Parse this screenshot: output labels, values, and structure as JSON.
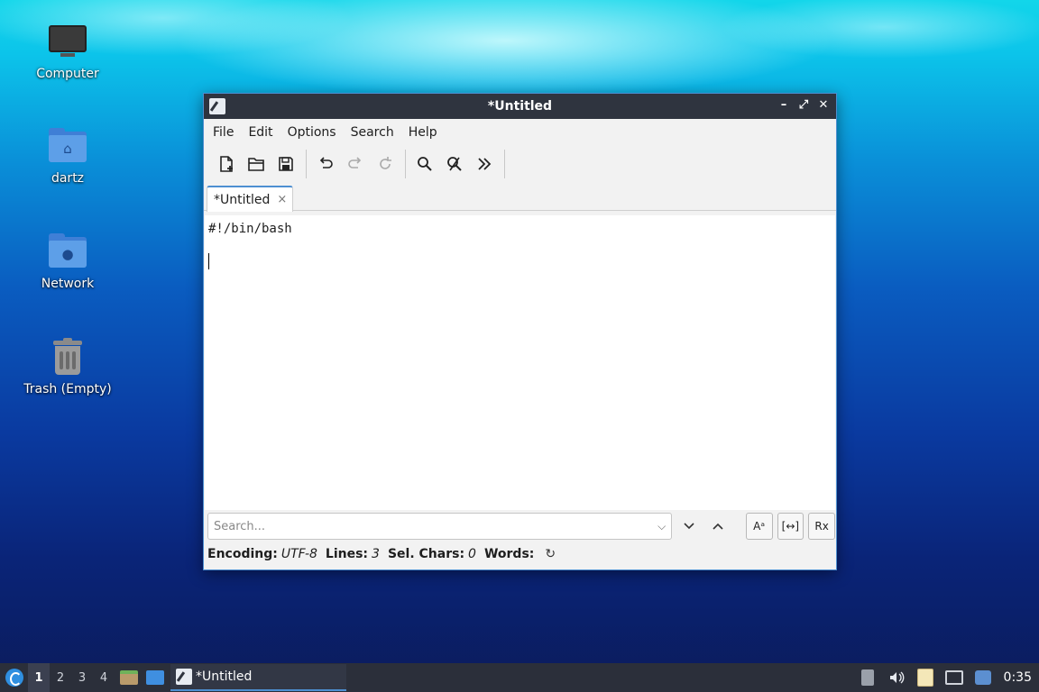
{
  "desktop": {
    "icons": [
      {
        "label": "Computer",
        "icon": "computer-icon"
      },
      {
        "label": "dartz",
        "icon": "home-folder-icon"
      },
      {
        "label": "Network",
        "icon": "network-folder-icon"
      },
      {
        "label": "Trash (Empty)",
        "icon": "trash-icon"
      }
    ]
  },
  "window": {
    "title": "*Untitled",
    "menus": [
      "File",
      "Edit",
      "Options",
      "Search",
      "Help"
    ],
    "toolbar": {
      "new_icon": "new-document-icon",
      "open_icon": "open-folder-icon",
      "save_icon": "save-icon",
      "undo_icon": "undo-icon",
      "redo_icon": "redo-icon",
      "reload_icon": "reload-icon",
      "find_icon": "search-icon",
      "replace_icon": "find-replace-icon",
      "more_icon": "more-chevrons-icon"
    },
    "tab": {
      "label": "*Untitled",
      "close": "×"
    },
    "editor": {
      "line1": "#!/bin/bash"
    },
    "search": {
      "placeholder": "Search...",
      "dropdown": "⌵",
      "down": "⌄",
      "up": "⌃",
      "match_case": "Aᵃ",
      "whole_word": "[↔]",
      "regex": "Rx"
    },
    "status": {
      "encoding_label": "Encoding:",
      "encoding_value": "UTF-8",
      "lines_label": "Lines:",
      "lines_value": "3",
      "selchars_label": "Sel. Chars:",
      "selchars_value": "0",
      "words_label": "Words:",
      "refresh": "↻"
    }
  },
  "taskbar": {
    "workspaces": [
      "1",
      "2",
      "3",
      "4"
    ],
    "active_workspace": "1",
    "task_label": "*Untitled",
    "clock": "0:35"
  }
}
